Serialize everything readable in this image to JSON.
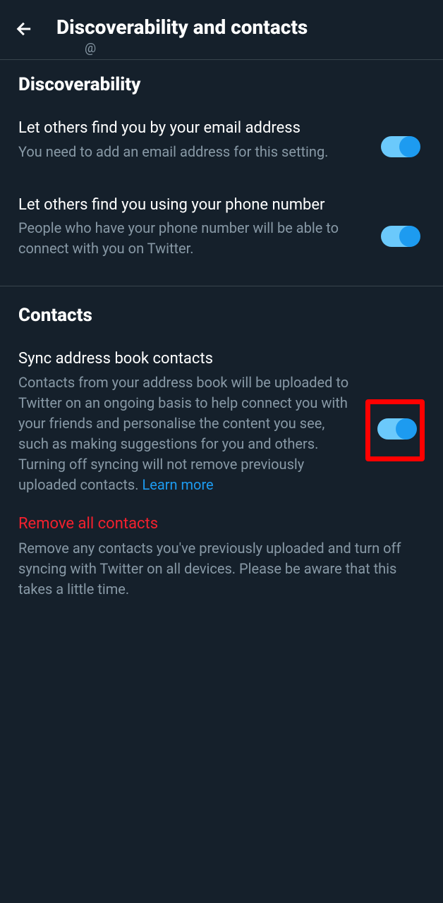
{
  "header": {
    "title": "Discoverability and contacts",
    "subtitle": "@"
  },
  "discoverability": {
    "title": "Discoverability",
    "email": {
      "label": "Let others find you by your email address",
      "desc": "You need to add an email address for this setting."
    },
    "phone": {
      "label": "Let others find you using your phone number",
      "desc": "People who have your phone number will be able to connect with you on Twitter."
    }
  },
  "contacts": {
    "title": "Contacts",
    "sync": {
      "label": "Sync address book contacts",
      "desc": "Contacts from your address book will be uploaded to Twitter on an ongoing basis to help connect you with your friends and personalise the content you see, such as making suggestions for you and others. Turning off syncing will not remove previously uploaded contacts. ",
      "link": "Learn more"
    },
    "remove": {
      "label": "Remove all contacts",
      "desc": "Remove any contacts you've previously uploaded and turn off syncing with Twitter on all devices. Please be aware that this takes a little time."
    }
  }
}
